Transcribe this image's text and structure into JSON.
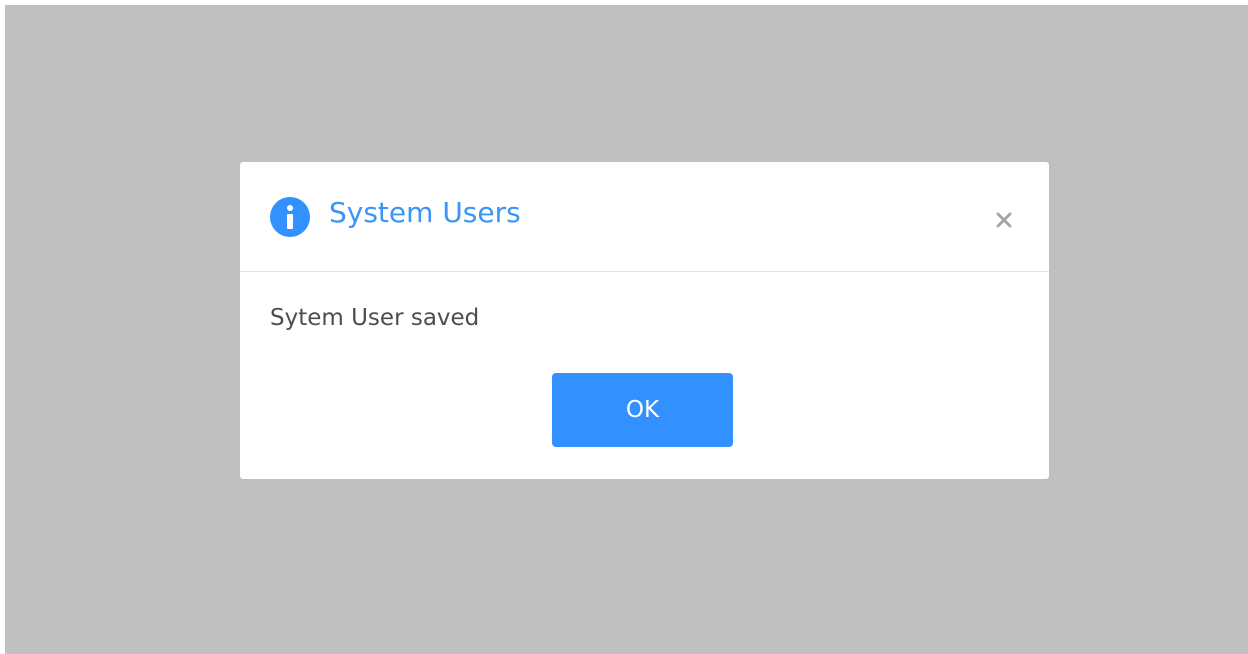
{
  "colors": {
    "backdrop": "#c0c0c0",
    "dialog_background": "#ffffff",
    "accent": "#3391ff",
    "title": "#3b95f6",
    "message_text": "#4d4d4d",
    "close_icon": "#a6a6a6"
  },
  "dialog": {
    "title": "System Users",
    "title_icon": "info-icon",
    "close_icon": "close-icon",
    "message": "Sytem User saved",
    "ok_label": "OK"
  }
}
